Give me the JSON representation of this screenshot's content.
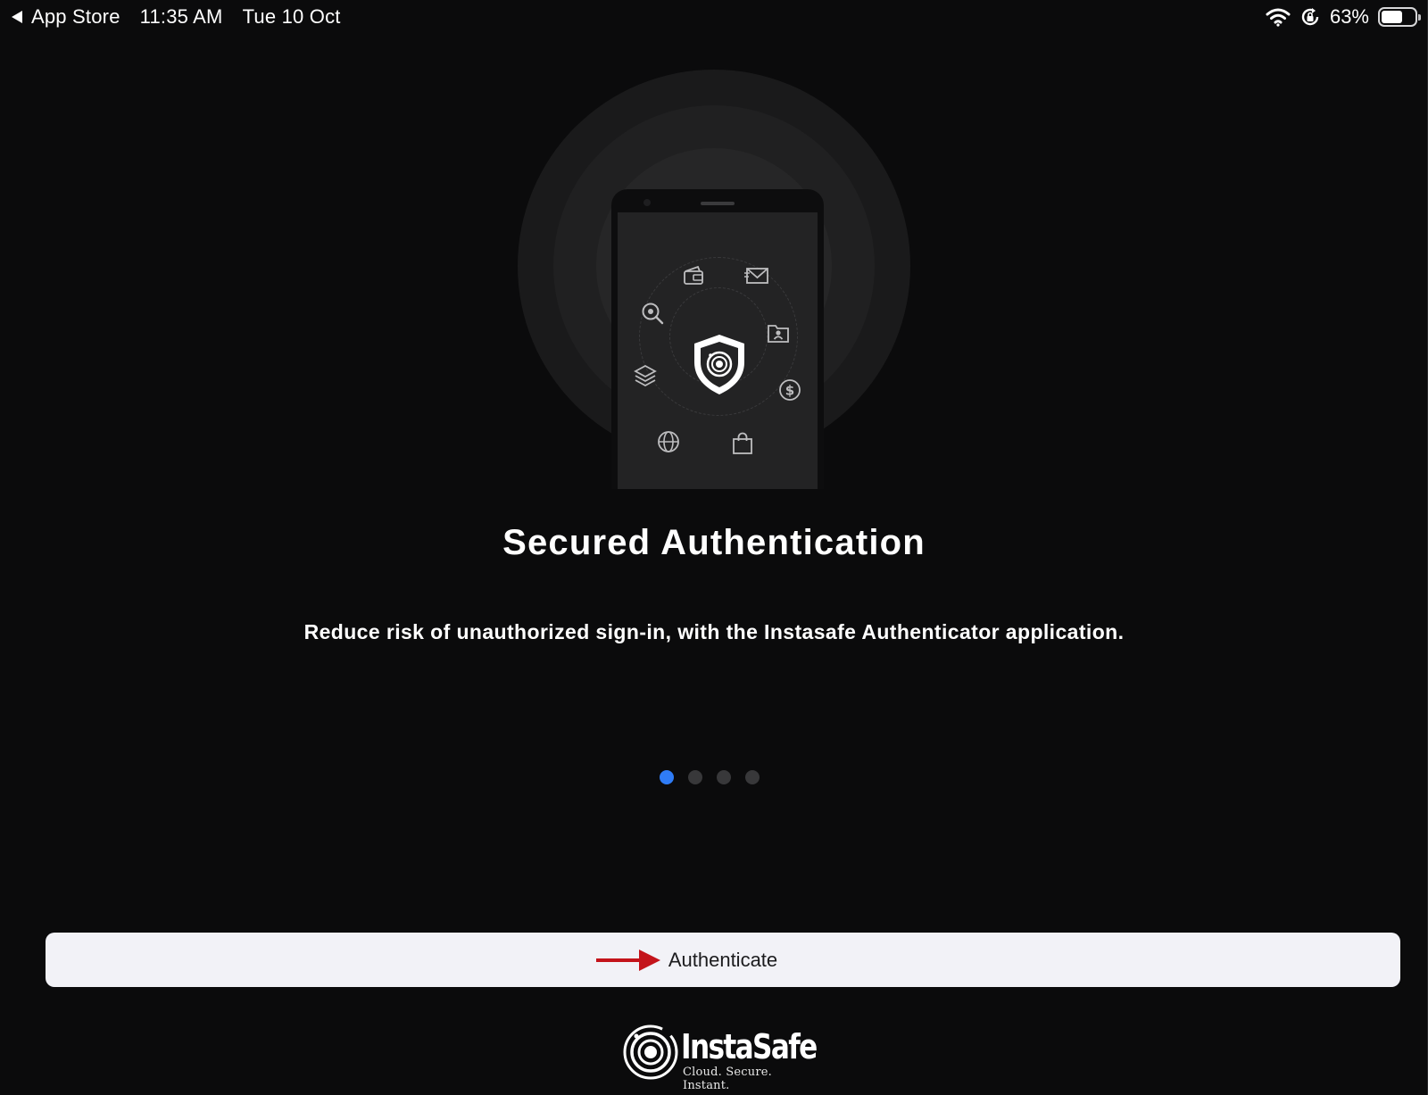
{
  "status_bar": {
    "back_app": "App Store",
    "time": "11:35 AM",
    "date": "Tue 10 Oct",
    "battery_percent": "63%",
    "battery_level": 0.63
  },
  "onboarding": {
    "title": "Secured Authentication",
    "subtitle": "Reduce risk of unauthorized sign-in, with the Instasafe Authenticator application.",
    "page_count": 4,
    "current_page": 1
  },
  "illustration": {
    "icons": [
      "shield-logo-icon",
      "wallet-icon",
      "mail-icon",
      "search-icon",
      "contact-folder-icon",
      "layers-icon",
      "dollar-icon",
      "globe-icon",
      "shopping-bag-icon"
    ]
  },
  "actions": {
    "authenticate_label": "Authenticate"
  },
  "brand": {
    "name": "InstaSafe",
    "tagline": "Cloud. Secure. Instant."
  },
  "colors": {
    "background": "#0b0b0c",
    "accent": "#2f7cf6",
    "button_bg": "#f2f2f7",
    "annotation_arrow": "#c4141b"
  }
}
